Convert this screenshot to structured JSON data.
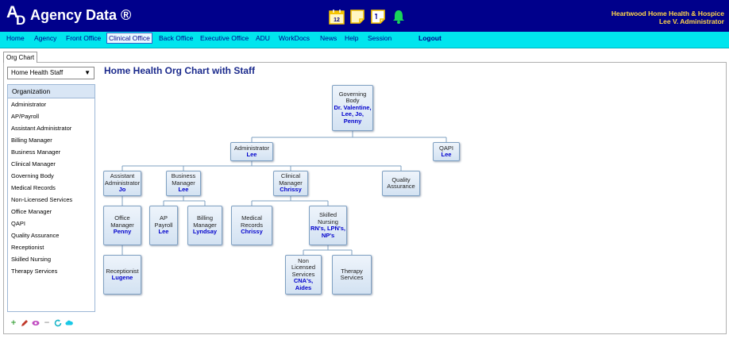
{
  "header": {
    "logo_letters": [
      "A",
      "D"
    ],
    "title": "Agency Data ®",
    "org_name": "Heartwood Home Health & Hospice",
    "user": "Lee V. Administrator",
    "calendar_day": "12",
    "icons": [
      "calendar-icon",
      "sticky-note-icon",
      "notes-icon",
      "bell-icon"
    ],
    "brand_color": "#00008b",
    "menubar_color": "#00e5ee",
    "accent_color": "#ffd54a"
  },
  "menu": {
    "items": [
      "Home",
      "Agency",
      "Front Office",
      "Clinical Office",
      "Back Office",
      "Executive Office",
      "ADU",
      "WorkDocs",
      "News",
      "Help",
      "Session"
    ],
    "active": "Clinical Office",
    "logout": "Logout"
  },
  "tabs": {
    "active": "Org Chart"
  },
  "sidebar": {
    "dropdown_value": "Home Health Staff",
    "list_header": "Organization",
    "items": [
      "Administrator",
      "AP/Payroll",
      "Assistant Administrator",
      "Billing Manager",
      "Business Manager",
      "Clinical Manager",
      "Governing Body",
      "Medical Records",
      "Non-Licensed Services",
      "Office Manager",
      "QAPI",
      "Quality Assurance",
      "Receptionist",
      "Skilled Nursing",
      "Therapy Services"
    ],
    "toolbar": [
      "add-icon",
      "edit-icon",
      "view-icon",
      "remove-icon",
      "refresh-icon",
      "cloud-icon"
    ]
  },
  "chart": {
    "title": "Home Health Org Chart with Staff",
    "nodes": {
      "governing_body": {
        "title": "Governing Body",
        "name": "Dr. Valentine, Lee, Jo, Penny"
      },
      "administrator": {
        "title": "Administrator",
        "name": "Lee"
      },
      "qapi": {
        "title": "QAPI",
        "name": "Lee"
      },
      "assistant_administrator": {
        "title": "Assistant Administrator",
        "name": "Jo"
      },
      "business_manager": {
        "title": "Business Manager",
        "name": "Lee"
      },
      "clinical_manager": {
        "title": "Clinical Manager",
        "name": "Chrissy"
      },
      "quality_assurance": {
        "title": "Quality Assurance",
        "name": ""
      },
      "office_manager": {
        "title": "Office Manager",
        "name": "Penny"
      },
      "ap_payroll": {
        "title": "AP Payroll",
        "name": "Lee"
      },
      "billing_manager": {
        "title": "Billing Manager",
        "name": "Lyndsay"
      },
      "medical_records": {
        "title": "Medical Records",
        "name": "Chrissy"
      },
      "skilled_nursing": {
        "title": "Skilled Nursing",
        "name": "RN's, LPN's, NP's"
      },
      "receptionist": {
        "title": "Receptionist",
        "name": "Lugene"
      },
      "non_licensed_services": {
        "title": "Non Licensed Services",
        "name": "CNA's, Aides"
      },
      "therapy_services": {
        "title": "Therapy Services",
        "name": ""
      }
    }
  }
}
